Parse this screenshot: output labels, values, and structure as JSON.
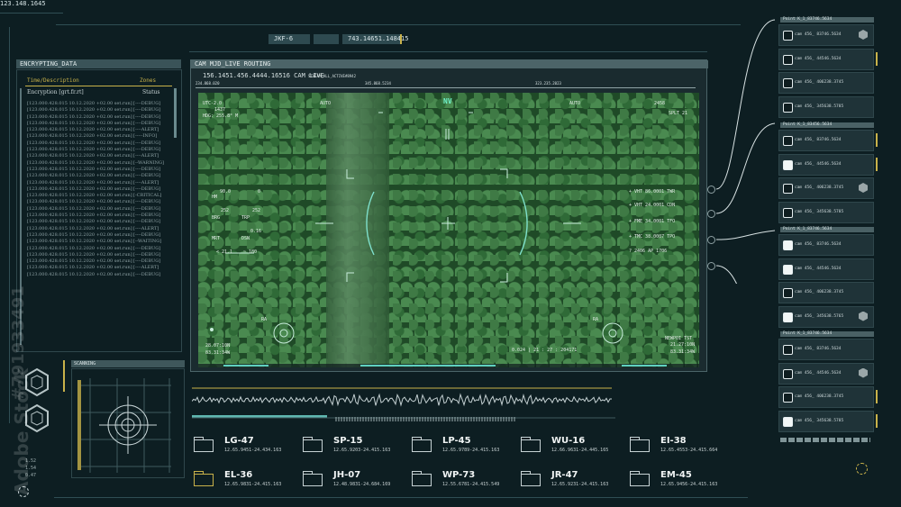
{
  "top": {
    "coord": "123.148.1645",
    "code_box": "JKF-6",
    "value_box": "743.14651.148415"
  },
  "encrypting": {
    "title": "ENCRYPTING_DATA",
    "col_time": "Time/Description",
    "col_zones": "Zones",
    "sub_label": "Encryption [grt.fr.rt]",
    "sub_status": "Status",
    "rows": [
      {
        "t": "[123.000.428.015 10.12.2020 +02.00 set.run]",
        "s": "[----DEBUG]"
      },
      {
        "t": "[123.000.428.015 10.12.2020 +02.00 set.run]",
        "s": "[----DEBUG]"
      },
      {
        "t": "[123.000.428.015 10.12.2020 +02.00 set.run]",
        "s": "[----DEBUG]"
      },
      {
        "t": "[123.000.428.015 10.12.2020 +02.00 set.run]",
        "s": "[----DEBUG]"
      },
      {
        "t": "[123.000.428.015 10.12.2020 +02.00 set.run]",
        "s": "[----ALERT]"
      },
      {
        "t": "[123.000.428.015 10.12.2020 +02.00 set.run]",
        "s": "[-----INFO]"
      },
      {
        "t": "[123.000.428.015 10.12.2020 +02.00 set.run]",
        "s": "[----DEBUG]"
      },
      {
        "t": "[123.000.428.015 10.12.2020 +02.00 set.run]",
        "s": "[----DEBUG]"
      },
      {
        "t": "[123.000.428.015 10.12.2020 +02.00 set.run]",
        "s": "[----ALERT]"
      },
      {
        "t": "[123.000.428.015 10.12.2020 +02.00 set.run]",
        "s": "[--WARNING]"
      },
      {
        "t": "[123.000.428.015 10.12.2020 +02.00 set.run]",
        "s": "[----DEBUG]"
      },
      {
        "t": "[123.000.428.015 10.12.2020 +02.00 set.run]",
        "s": "[----DEBUG]"
      },
      {
        "t": "[123.000.428.015 10.12.2020 +02.00 set.run]",
        "s": "[----ALERT]"
      },
      {
        "t": "[123.000.428.015 10.12.2020 +02.00 set.run]",
        "s": "[----DEBUG]"
      },
      {
        "t": "[123.000.428.015 10.12.2020 +02.00 set.run]",
        "s": "[-CRITICAL]"
      },
      {
        "t": "[123.000.428.015 10.12.2020 +02.00 set.run]",
        "s": "[----DEBUG]"
      },
      {
        "t": "[123.000.428.015 10.12.2020 +02.00 set.run]",
        "s": "[----DEBUG]"
      },
      {
        "t": "[123.000.428.015 10.12.2020 +02.00 set.run]",
        "s": "[----DEBUG]"
      },
      {
        "t": "[123.000.428.015 10.12.2020 +02.00 set.run]",
        "s": "[----DEBUG]"
      },
      {
        "t": "[123.000.428.015 10.12.2020 +02.00 set.run]",
        "s": "[----ALERT]"
      },
      {
        "t": "[123.000.428.015 10.12.2020 +02.00 set.run]",
        "s": "[----DEBUG]"
      },
      {
        "t": "[123.000.428.015 10.12.2020 +02.00 set.run]",
        "s": "[--WAITING]"
      },
      {
        "t": "[123.000.428.015 10.12.2020 +02.00 set.run]",
        "s": "[----DEBUG]"
      },
      {
        "t": "[123.000.428.015 10.12.2020 +02.00 set.run]",
        "s": "[----DEBUG]"
      },
      {
        "t": "[123.000.428.015 10.12.2020 +02.00 set.run]",
        "s": "[----DEBUG]"
      },
      {
        "t": "[123.000.428.015 10.12.2020 +02.00 set.run]",
        "s": "[----ALERT]"
      },
      {
        "t": "[123.000.428.015 10.12.2020 +02.00 set.run]",
        "s": "[----DEBUG]"
      }
    ]
  },
  "camera": {
    "title": "CAM MJD_LIVE ROUTING",
    "stream_label": "156.1451.456.4444.16516 CAM LIVE",
    "stream_tag": "STREAM_ALL_ACTIVE#8942",
    "scale": [
      "234.868.020",
      "345.868.5234",
      "323.235.2023"
    ],
    "hud": {
      "nv": "NV",
      "auto_left": "AUTO",
      "auto_right": "AUTO",
      "utc": "UTC-2.0",
      "utc_val": "1437",
      "hdg": "HDG: 255.8° M",
      "right_top": "2458",
      "splt": "SPLT    21",
      "hm": "HM",
      "hm_val": "90.0",
      "hm_val2": "0",
      "brg": "BRG",
      "brg_val": "252",
      "brg_val2": "252",
      "trp": "TRP",
      "mrt": "MRT",
      "dsn": "DSN",
      "dsn_val": "0.16",
      "neg": "< 21.1",
      "neg2": "~ 180",
      "r1": "+ VHT    86.0001   TWR",
      "r2": "+ VHT    24.0001   CDN",
      "r3": "+ FME    34.0001   TFO",
      "r4": "+ TMC    38.0007   TPO",
      "r5": "?    2406    AP    1706",
      "ra_left": "RA",
      "ra_right": "RA",
      "coord_left1": "28.07:10N",
      "coord_left2": "83.31:34W",
      "center_code": "0.024 | 21 : 27 : 204171",
      "newpoi": "NEWPOI TST",
      "coord_right1": "21.27:10N",
      "coord_right2": "83.31:34W"
    }
  },
  "scanning": {
    "title": "SCANNING"
  },
  "left_nums": [
    "1.52",
    "1.54",
    "0.47"
  ],
  "cam_groups": [
    {
      "title": "Point K_1_83746.5634",
      "items": [
        {
          "label": "cam 456_ 83746.5634",
          "on": false,
          "hex": true,
          "mark": false
        },
        {
          "label": "cam 456_ 44546.5634",
          "on": false,
          "hex": false,
          "mark": true
        },
        {
          "label": "cam 456_ 406238.3745",
          "on": false,
          "hex": false,
          "mark": false
        },
        {
          "label": "cam 456_ 345638.5785",
          "on": false,
          "hex": false,
          "mark": false
        }
      ]
    },
    {
      "title": "Point K_1_83456.5634",
      "items": [
        {
          "label": "cam 456_ 83746.5634",
          "on": false,
          "hex": false,
          "mark": true
        },
        {
          "label": "cam 456_ 44546.5634",
          "on": true,
          "hex": false,
          "mark": true
        },
        {
          "label": "cam 456_ 406238.3745",
          "on": false,
          "hex": true,
          "mark": false
        },
        {
          "label": "cam 456_ 345638.5785",
          "on": false,
          "hex": false,
          "mark": false
        }
      ]
    },
    {
      "title": "Point K_1_83746.5634",
      "items": [
        {
          "label": "cam 456_ 83746.5634",
          "on": true,
          "hex": false,
          "mark": false
        },
        {
          "label": "cam 456_ 44546.5634",
          "on": true,
          "hex": false,
          "mark": false
        },
        {
          "label": "cam 456_ 406238.3745",
          "on": false,
          "hex": false,
          "mark": false
        },
        {
          "label": "cam 456_ 345638.5765",
          "on": true,
          "hex": true,
          "mark": false
        }
      ]
    },
    {
      "title": "Point K_1_83746.5634",
      "items": [
        {
          "label": "cam 456_ 83746.5634",
          "on": false,
          "hex": false,
          "mark": false
        },
        {
          "label": "cam 456_ 44546.5634",
          "on": false,
          "hex": true,
          "mark": false
        },
        {
          "label": "cam 456_ 406238.3745",
          "on": false,
          "hex": false,
          "mark": true
        },
        {
          "label": "cam 456_ 345638.5785",
          "on": true,
          "hex": false,
          "mark": true
        }
      ]
    }
  ],
  "folders": [
    {
      "name": "LG-47",
      "coord": "12.65.9451-24.434.163",
      "hl": false
    },
    {
      "name": "SP-15",
      "coord": "12.65.9203-24.415.163",
      "hl": false
    },
    {
      "name": "LP-45",
      "coord": "12.65.9789-24.415.163",
      "hl": false
    },
    {
      "name": "WU-16",
      "coord": "12.66.9631-24.445.165",
      "hl": false
    },
    {
      "name": "EI-38",
      "coord": "12.65.4553-24.415.664",
      "hl": false
    },
    {
      "name": "EL-36",
      "coord": "12.65.9831-24.415.163",
      "hl": true
    },
    {
      "name": "JH-07",
      "coord": "12.48.9831-24.684.169",
      "hl": false
    },
    {
      "name": "WP-73",
      "coord": "12.55.6781-24.415.549",
      "hl": false
    },
    {
      "name": "JR-47",
      "coord": "12.65.9231-24.415.163",
      "hl": false
    },
    {
      "name": "EM-45",
      "coord": "12.65.9456-24.415.163",
      "hl": false
    }
  ],
  "watermarks": [
    "Adobe Stock",
    "#791933491"
  ],
  "colors": {
    "accent": "#c9b24a",
    "panel": "#3a5358",
    "bg": "#0d1e22"
  }
}
